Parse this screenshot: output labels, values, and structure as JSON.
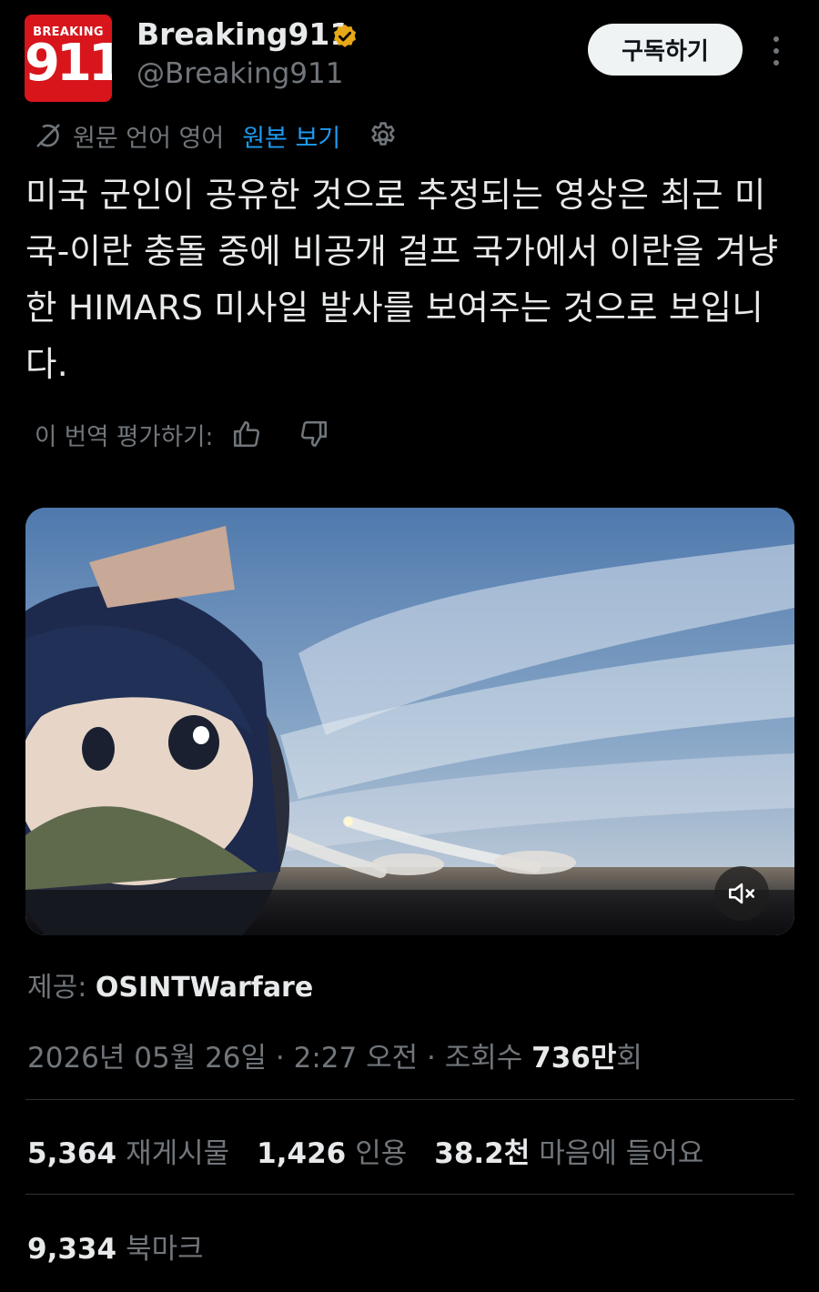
{
  "header": {
    "logo_top": "BREAKING",
    "logo_main": "911",
    "display_name": "Breaking911",
    "handle": "@Breaking911",
    "subscribe_label": "구독하기",
    "badge_color": "#e6a817"
  },
  "translation": {
    "source_language": "원문 언어 영어",
    "view_original": "원본 보기"
  },
  "tweet": {
    "text": "미국 군인이 공유한 것으로 추정되는 영상은 최근 미국-이란 충돌 중에 비공개 걸프 국가에서 이란을 겨냥한 HIMARS 미사일 발사를 보여주는 것으로 보입니다."
  },
  "rating": {
    "label": "이 번역 평가하기:"
  },
  "credit": {
    "prefix": "제공:",
    "source": "OSINTWarfare"
  },
  "meta": {
    "date": "2026년 05월 26일",
    "time": "2:27 오전",
    "views_label": "조회수",
    "views_value": "736만",
    "views_suffix": "회"
  },
  "stats": {
    "reposts_value": "5,364",
    "reposts_label": "재게시물",
    "quotes_value": "1,426",
    "quotes_label": "인용",
    "likes_value": "38.2천",
    "likes_label": "마음에 들어요",
    "bookmarks_value": "9,334",
    "bookmarks_label": "북마크"
  },
  "colors": {
    "accent": "#1d9bf0",
    "background": "#000000",
    "logo_red": "#d7151b"
  }
}
